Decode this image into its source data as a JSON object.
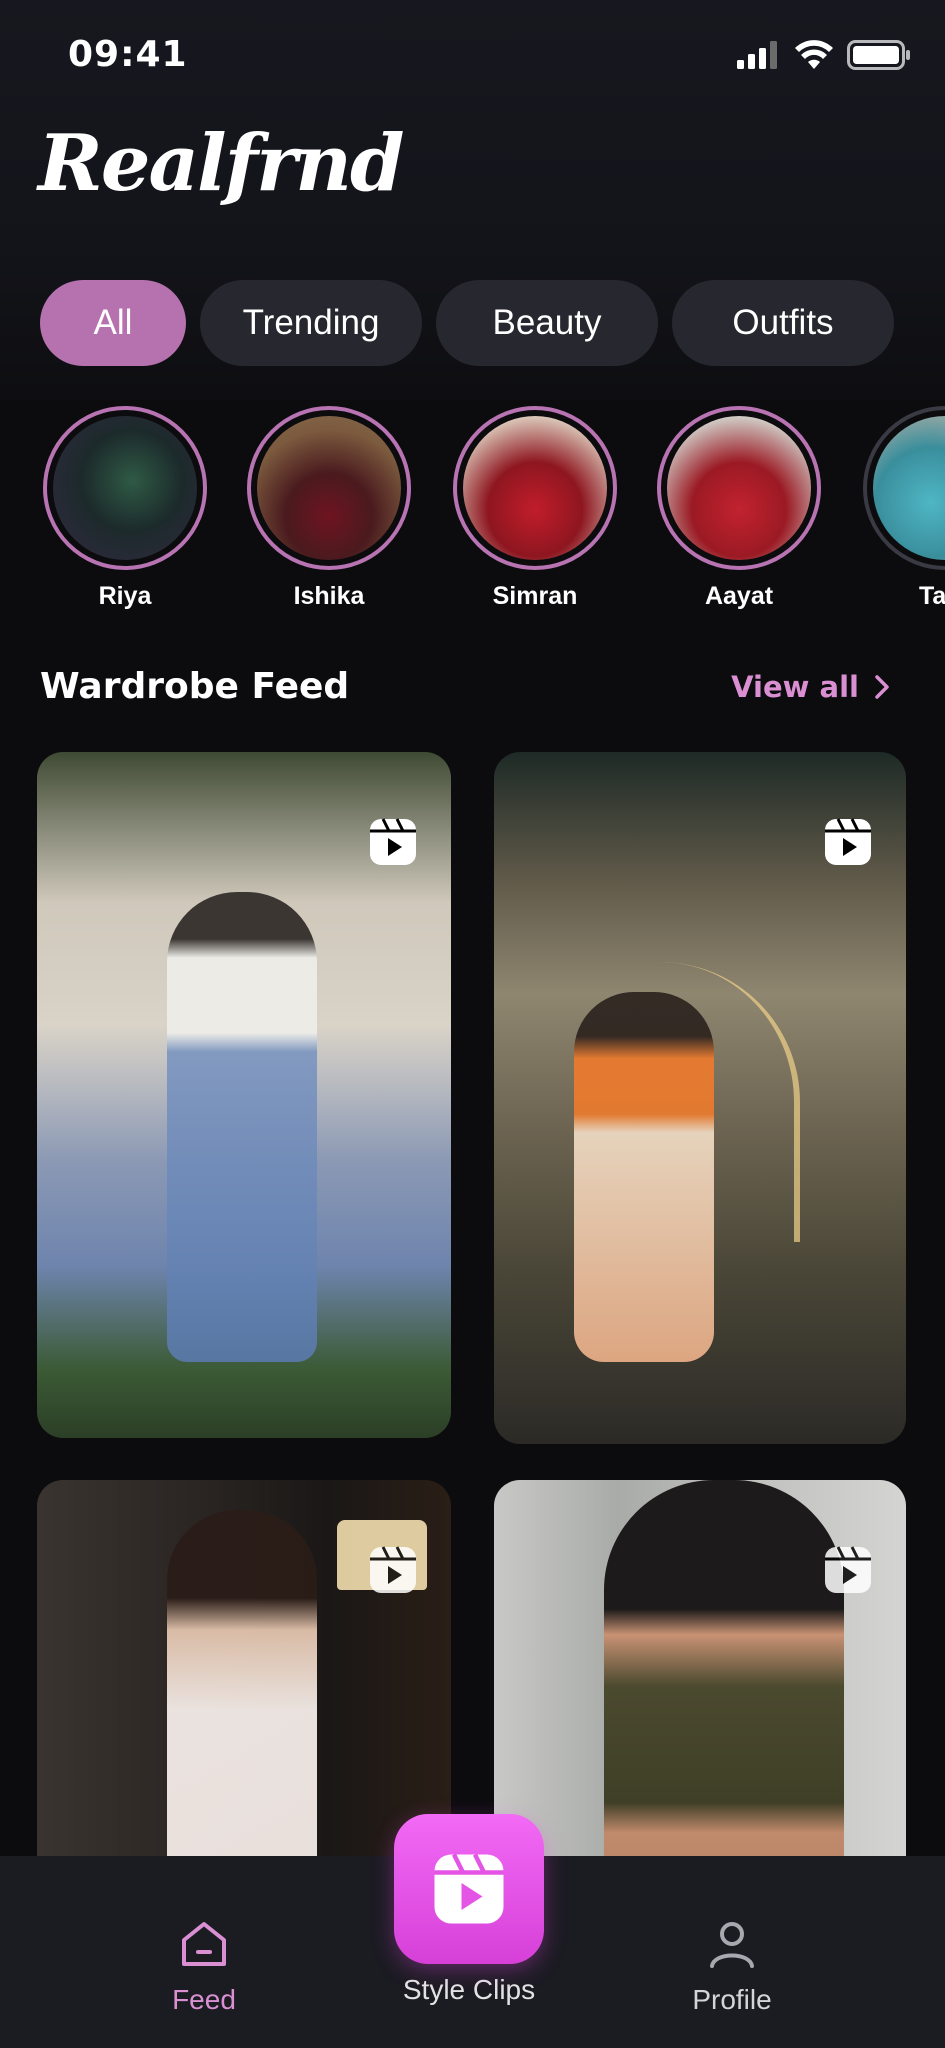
{
  "status_bar": {
    "time": "09:41"
  },
  "app": {
    "logo": "Realfrnd"
  },
  "chips": [
    {
      "label": "All",
      "active": true
    },
    {
      "label": "Trending",
      "active": false
    },
    {
      "label": "Beauty",
      "active": false
    },
    {
      "label": "Outfits",
      "active": false
    }
  ],
  "stories": [
    {
      "name": "Riya"
    },
    {
      "name": "Ishika"
    },
    {
      "name": "Simran"
    },
    {
      "name": "Aayat"
    },
    {
      "name": "Tan"
    }
  ],
  "feed": {
    "title": "Wardrobe Feed",
    "view_all": "View all"
  },
  "bottom_nav": {
    "feed": "Feed",
    "style_clips": "Style Clips",
    "profile": "Profile"
  },
  "colors": {
    "accent": "#b672ae",
    "accent_text": "#d98fd2",
    "center_button": "#e455e6",
    "background": "#0c0c0e"
  }
}
